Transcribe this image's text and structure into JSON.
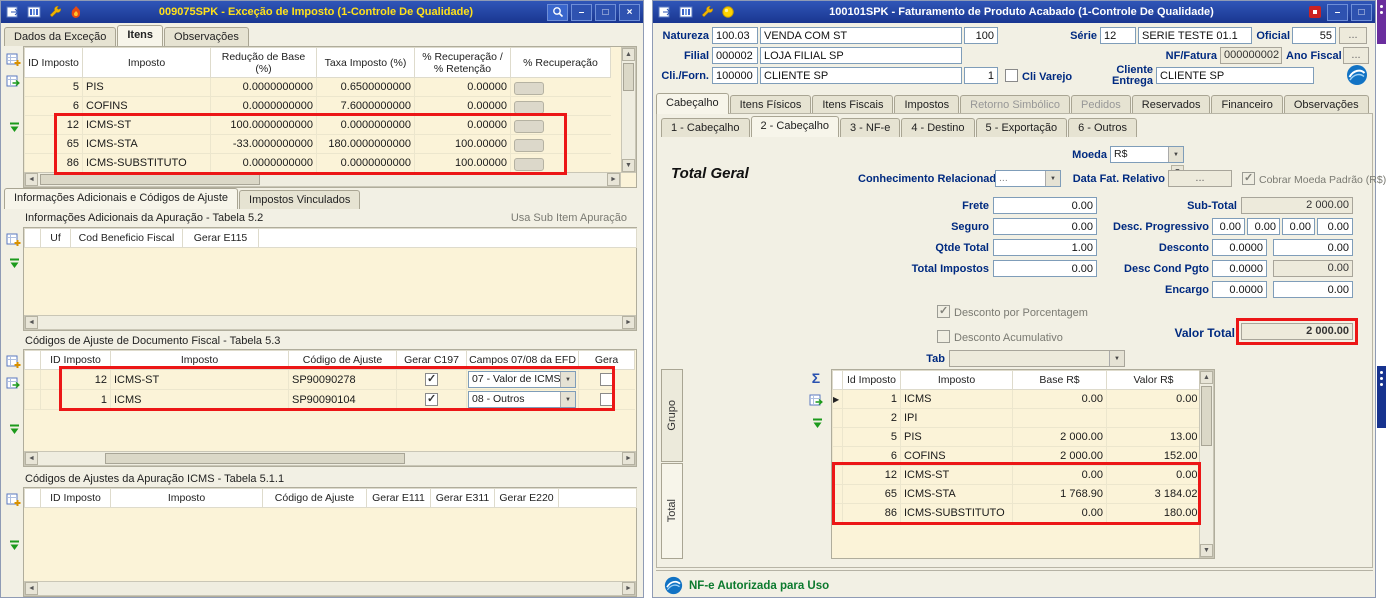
{
  "glyphs": {
    "minimize": "–",
    "maximize": "□",
    "close": "×",
    "dropdown": "▼",
    "check": "✓",
    "scroll_up": "▲",
    "scroll_down": "▼",
    "scroll_left": "◄",
    "scroll_right": "►",
    "row_marker": "▶",
    "sigma": "Σ"
  },
  "lw": {
    "title": "009075SPK - Exceção de Imposto (1-Controle De Qualidade)",
    "tabs": [
      "Dados da Exceção",
      "Itens",
      "Observações"
    ],
    "grid1": {
      "headers": [
        "ID Imposto",
        "Imposto",
        "Redução de Base (%)",
        "Taxa Imposto (%)",
        "% Recuperação / % Retenção",
        "% Recuperação"
      ],
      "rows": [
        [
          "5",
          "PIS",
          "0.0000000000",
          "0.6500000000",
          "0.00000"
        ],
        [
          "6",
          "COFINS",
          "0.0000000000",
          "7.6000000000",
          "0.00000"
        ],
        [
          "12",
          "ICMS-ST",
          "100.0000000000",
          "0.0000000000",
          "0.00000"
        ],
        [
          "65",
          "ICMS-STA",
          "-33.0000000000",
          "180.0000000000",
          "100.00000"
        ],
        [
          "86",
          "ICMS-SUBSTITUTO",
          "0.0000000000",
          "0.0000000000",
          "100.00000"
        ]
      ]
    },
    "tabs2": [
      "Informações Adicionais e Códigos de Ajuste",
      "Impostos Vinculados"
    ],
    "s52": {
      "title": "Informações Adicionais da Apuração - Tabela 5.2",
      "note": "Usa Sub Item Apuração",
      "headers": [
        "Uf",
        "Cod Beneficio Fiscal",
        "Gerar E115"
      ]
    },
    "s53": {
      "title": "Códigos de Ajuste de Documento Fiscal - Tabela 5.3",
      "headers": [
        "ID Imposto",
        "Imposto",
        "Código de Ajuste",
        "Gerar C197",
        "Campos 07/08 da EFD",
        "Gera"
      ],
      "rows": [
        {
          "id": "12",
          "imposto": "ICMS-ST",
          "codigo": "SP90090278",
          "c197": true,
          "campos": "07 - Valor de ICMS",
          "extra": false
        },
        {
          "id": "1",
          "imposto": "ICMS",
          "codigo": "SP90090104",
          "c197": true,
          "campos": "08 - Outros",
          "extra": false
        }
      ]
    },
    "s511": {
      "title": "Códigos de Ajustes da Apuração ICMS - Tabela 5.1.1",
      "headers": [
        "ID Imposto",
        "Imposto",
        "Código de Ajuste",
        "Gerar E111",
        "Gerar E311",
        "Gerar E220"
      ]
    }
  },
  "rw": {
    "title": "100101SPK - Faturamento de Produto Acabado (1-Controle De Qualidade)",
    "form": {
      "natureza_label": "Natureza",
      "natureza_code": "100.03",
      "natureza_desc": "VENDA COM ST",
      "natureza_tipo": "100",
      "serie_label": "Série",
      "serie_code": "12",
      "serie_desc": "SERIE TESTE 01.1",
      "oficial_label": "Oficial",
      "oficial_value": "55",
      "oficial_browse": "...",
      "filial_label": "Filial",
      "filial_code": "000002",
      "filial_desc": "LOJA FILIAL SP",
      "nf_label": "NF/Fatura",
      "nf_value": "000000002",
      "ano_label": "Ano Fiscal",
      "ano_value": "...",
      "cli_label": "Cli./Forn.",
      "cli_code": "100000",
      "cli_desc": "CLIENTE SP",
      "cli_loja": "1",
      "cli_varejo_label": "Cli Varejo",
      "cli_varejo_checked": false,
      "entrega_label": "Cliente Entrega",
      "entrega_value": "CLIENTE SP"
    },
    "tabs": [
      "Cabeçalho",
      "Itens Físicos",
      "Itens Fiscais",
      "Impostos",
      "Retorno Simbólico",
      "Pedidos",
      "Reservados",
      "Financeiro",
      "Observações"
    ],
    "subtabs": [
      "1 - Cabeçalho",
      "2 - Cabeçalho",
      "3 - NF-e",
      "4 - Destino",
      "5 - Exportação",
      "6 - Outros"
    ],
    "totals": {
      "moeda_label": "Moeda",
      "moeda_value": "R$",
      "total_geral_label": "Total Geral",
      "conhecimento_label": "Conhecimento Relacionado",
      "conhecimento_value": "...",
      "data_fat_label": "Data Fat. Relativo",
      "data_fat_value": "...",
      "cobrar_moeda_label": "Cobrar Moeda Padrão (R$)",
      "cobrar_moeda_checked": true,
      "frete_label": "Frete",
      "frete_value": "0.00",
      "seguro_label": "Seguro",
      "seguro_value": "0.00",
      "qtde_label": "Qtde Total",
      "qtde_value": "1.00",
      "total_impostos_label": "Total Impostos",
      "total_impostos_value": "0.00",
      "subtotal_label": "Sub-Total",
      "subtotal_value": "2 000.00",
      "desc_prog_label": "Desc. Progressivo",
      "desc_prog_1": "0.00",
      "desc_prog_2": "0.00",
      "desc_prog_3": "0.00",
      "desc_prog_4": "0.00",
      "desconto_label": "Desconto",
      "desconto_pct": "0.0000",
      "desconto_valor": "0.00",
      "desc_cond_label": "Desc Cond Pgto",
      "desc_cond_pct": "0.0000",
      "desc_cond_valor": "0.00",
      "encargo_label": "Encargo",
      "encargo_pct": "0.0000",
      "encargo_valor": "0.00",
      "desc_porcentagem_label": "Desconto por Porcentagem",
      "desc_porcentagem_checked": true,
      "desc_acumulativo_label": "Desconto Acumulativo",
      "desc_acumulativo_checked": false,
      "valor_total_label": "Valor Total",
      "valor_total_value": "2 000.00",
      "tab_label": "Tab"
    },
    "grid": {
      "side_tabs": [
        "Grupo",
        "Total"
      ],
      "headers": [
        "Id Imposto",
        "Imposto",
        "Base R$",
        "Valor R$"
      ],
      "rows": [
        [
          "1",
          "ICMS",
          "0.00",
          "0.00"
        ],
        [
          "2",
          "IPI",
          "",
          ""
        ],
        [
          "5",
          "PIS",
          "2 000.00",
          "13.00"
        ],
        [
          "6",
          "COFINS",
          "2 000.00",
          "152.00"
        ],
        [
          "12",
          "ICMS-ST",
          "0.00",
          "0.00"
        ],
        [
          "65",
          "ICMS-STA",
          "1 768.90",
          "3 184.02"
        ],
        [
          "86",
          "ICMS-SUBSTITUTO",
          "0.00",
          "180.00"
        ]
      ]
    },
    "status": "NF-e Autorizada para Uso"
  }
}
